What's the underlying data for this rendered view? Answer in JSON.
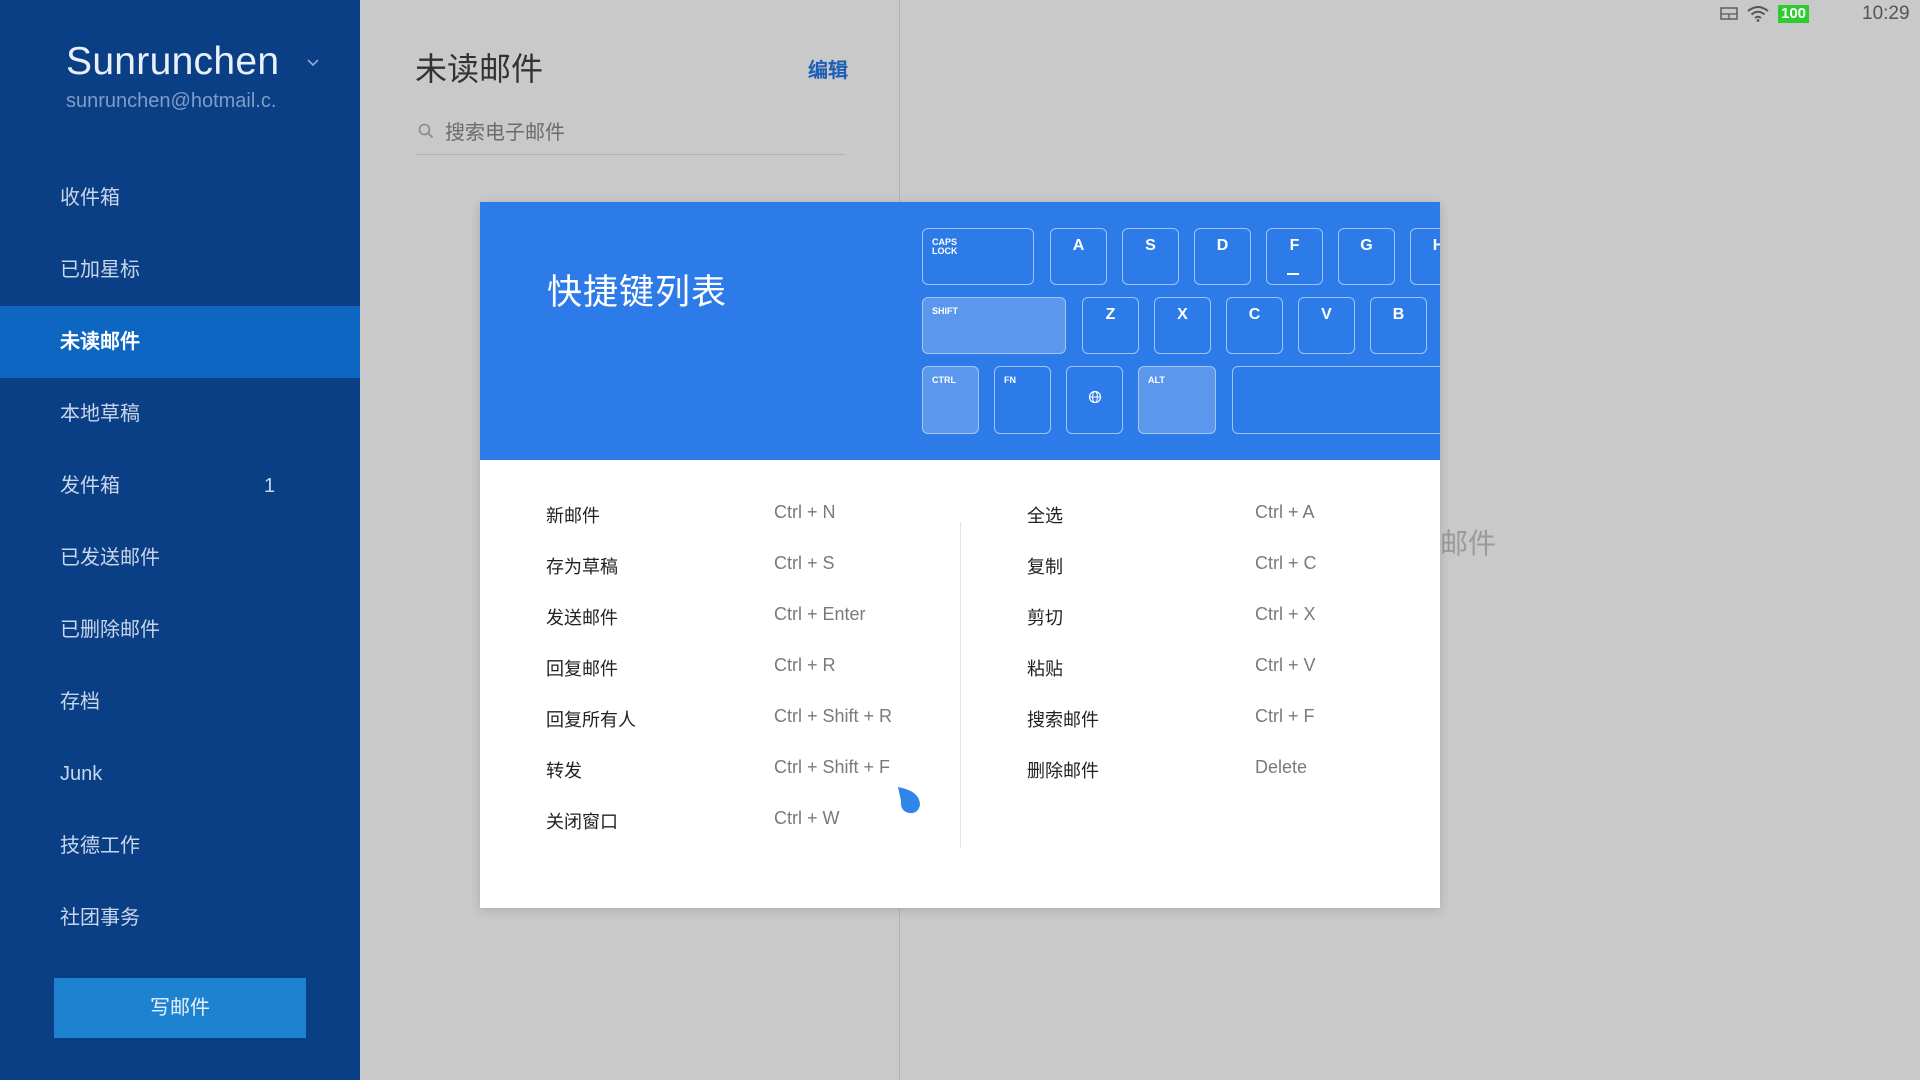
{
  "status_bar": {
    "battery": "100",
    "time": "10:29",
    "battery_color": "#2ecc2e"
  },
  "sidebar": {
    "account_name": "Sunrunchen",
    "account_email": "sunrunchen@hotmail.c.",
    "items": [
      {
        "label": "收件箱",
        "count": ""
      },
      {
        "label": "已加星标",
        "count": ""
      },
      {
        "label": "未读邮件",
        "count": "",
        "active": true
      },
      {
        "label": "本地草稿",
        "count": ""
      },
      {
        "label": "发件箱",
        "count": "1"
      },
      {
        "label": "已发送邮件",
        "count": ""
      },
      {
        "label": "已删除邮件",
        "count": ""
      },
      {
        "label": "存档",
        "count": ""
      },
      {
        "label": "Junk",
        "count": ""
      },
      {
        "label": "技德工作",
        "count": ""
      },
      {
        "label": "社团事务",
        "count": ""
      }
    ],
    "compose_label": "写邮件",
    "bg_color": "#0a3f86",
    "active_color": "#0d66c2"
  },
  "list_pane": {
    "title": "未读邮件",
    "edit_label": "编辑",
    "search_placeholder": "搜索电子邮件",
    "empty_hint_fragment": "邮件"
  },
  "modal": {
    "title": "快捷键列表",
    "header_color": "#2d7be8",
    "keyboard": {
      "row1": [
        "CAPS LOCK",
        "A",
        "S",
        "D",
        "F",
        "G",
        "H"
      ],
      "row2": [
        "SHIFT",
        "Z",
        "X",
        "C",
        "V",
        "B"
      ],
      "row3": [
        "CTRL",
        "FN",
        "globe",
        "ALT",
        "space"
      ]
    },
    "shortcuts_left": [
      {
        "label": "新邮件",
        "keys": "Ctrl + N"
      },
      {
        "label": "存为草稿",
        "keys": "Ctrl + S"
      },
      {
        "label": "发送邮件",
        "keys": "Ctrl + Enter"
      },
      {
        "label": "回复邮件",
        "keys": "Ctrl + R"
      },
      {
        "label": "回复所有人",
        "keys": "Ctrl + Shift + R"
      },
      {
        "label": "转发",
        "keys": "Ctrl + Shift + F"
      },
      {
        "label": "关闭窗口",
        "keys": "Ctrl + W"
      }
    ],
    "shortcuts_right": [
      {
        "label": "全选",
        "keys": "Ctrl + A"
      },
      {
        "label": "复制",
        "keys": "Ctrl + C"
      },
      {
        "label": "剪切",
        "keys": "Ctrl + X"
      },
      {
        "label": "粘贴",
        "keys": "Ctrl + V"
      },
      {
        "label": "搜索邮件",
        "keys": "Ctrl + F"
      },
      {
        "label": "删除邮件",
        "keys": "Delete"
      }
    ]
  }
}
